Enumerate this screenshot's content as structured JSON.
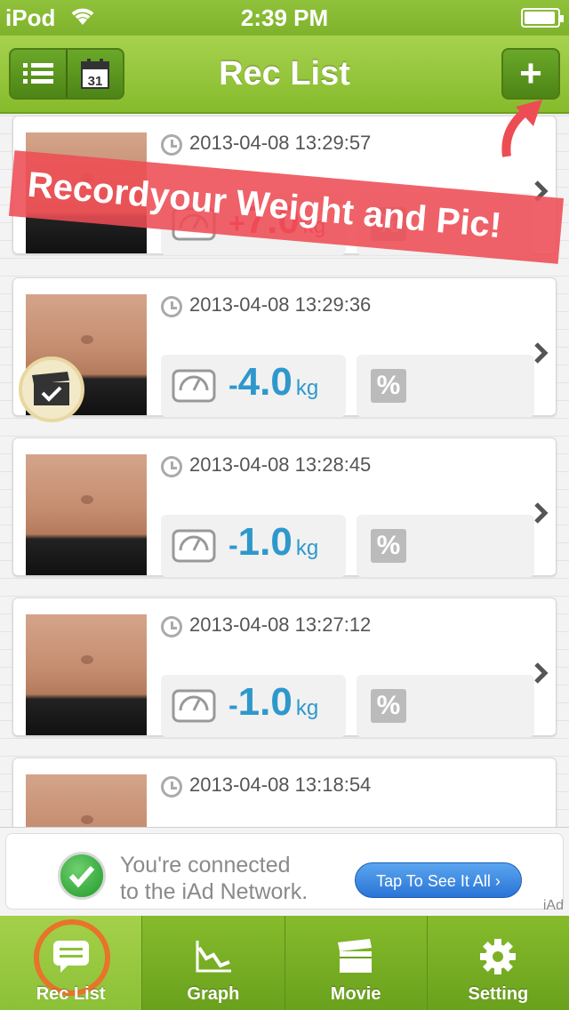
{
  "status_bar": {
    "carrier": "iPod",
    "time": "2:39 PM"
  },
  "nav": {
    "title": "Rec List",
    "add_label": "+"
  },
  "promo": {
    "text": "Recordyour Weight and Pic!"
  },
  "records": [
    {
      "date": "2013-04-08 13:29:57",
      "sign": "+",
      "value": "7.0",
      "unit": "kg",
      "trend": "up",
      "has_video": false
    },
    {
      "date": "2013-04-08 13:29:36",
      "sign": "-",
      "value": "4.0",
      "unit": "kg",
      "trend": "down",
      "has_video": true
    },
    {
      "date": "2013-04-08 13:28:45",
      "sign": "-",
      "value": "1.0",
      "unit": "kg",
      "trend": "down",
      "has_video": false
    },
    {
      "date": "2013-04-08 13:27:12",
      "sign": "-",
      "value": "1.0",
      "unit": "kg",
      "trend": "down",
      "has_video": false
    },
    {
      "date": "2013-04-08 13:18:54",
      "sign": "",
      "value": "",
      "unit": "",
      "trend": "",
      "has_video": false
    }
  ],
  "percent_label": "%",
  "iad": {
    "line1": "You're connected",
    "line2": "to the iAd Network.",
    "button": "Tap To See It All",
    "label": "iAd"
  },
  "tabs": [
    {
      "label": "Rec List",
      "icon": "speech-bubble-icon"
    },
    {
      "label": "Graph",
      "icon": "graph-icon"
    },
    {
      "label": "Movie",
      "icon": "clapperboard-icon"
    },
    {
      "label": "Setting",
      "icon": "gear-icon"
    }
  ],
  "colors": {
    "accent": "#86bb2c",
    "positive": "#ee4466",
    "negative": "#2e98cc",
    "promo": "#ee4c54",
    "ring": "#e8732a"
  }
}
